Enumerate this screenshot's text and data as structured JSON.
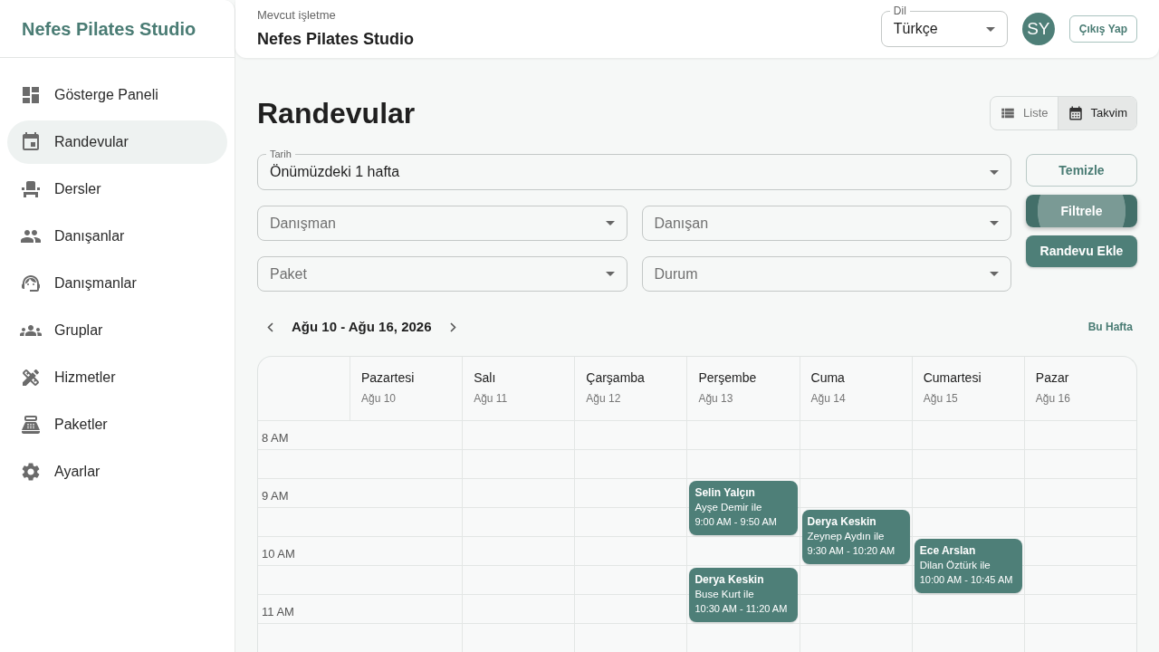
{
  "sidebar": {
    "logo": "Nefes Pilates Studio",
    "items": [
      {
        "label": "Gösterge Paneli",
        "selected": false
      },
      {
        "label": "Randevular",
        "selected": true
      },
      {
        "label": "Dersler",
        "selected": false
      },
      {
        "label": "Danışanlar",
        "selected": false
      },
      {
        "label": "Danışmanlar",
        "selected": false
      },
      {
        "label": "Gruplar",
        "selected": false
      },
      {
        "label": "Hizmetler",
        "selected": false
      },
      {
        "label": "Paketler",
        "selected": false
      },
      {
        "label": "Ayarlar",
        "selected": false
      }
    ]
  },
  "header": {
    "caption": "Mevcut işletme",
    "business": "Nefes Pilates Studio",
    "language": {
      "label": "Dil",
      "value": "Türkçe"
    },
    "avatar": "SY",
    "logout": "Çıkış Yap"
  },
  "page": {
    "title": "Randevular",
    "views": [
      {
        "label": "Liste",
        "selected": false
      },
      {
        "label": "Takvim",
        "selected": true
      }
    ]
  },
  "filters": {
    "date": {
      "label": "Tarih",
      "value": "Önümüzdeki 1 hafta"
    },
    "selects": [
      {
        "placeholder": "Danışman"
      },
      {
        "placeholder": "Danışan"
      },
      {
        "placeholder": "Paket"
      },
      {
        "placeholder": "Durum"
      }
    ],
    "buttons": [
      {
        "label": "Temizle",
        "kind": "outlined",
        "focused": false
      },
      {
        "label": "Filtrele",
        "kind": "contained",
        "focused": true
      },
      {
        "label": "Randevu Ekle",
        "kind": "contained",
        "focused": false
      }
    ]
  },
  "week": {
    "range": "Ağu 10 - Ağu 16, 2026",
    "current": "Bu Hafta"
  },
  "calendar": {
    "days": [
      {
        "name": "Pazartesi",
        "date": "Ağu 10"
      },
      {
        "name": "Salı",
        "date": "Ağu 11"
      },
      {
        "name": "Çarşamba",
        "date": "Ağu 12"
      },
      {
        "name": "Perşembe",
        "date": "Ağu 13"
      },
      {
        "name": "Cuma",
        "date": "Ağu 14"
      },
      {
        "name": "Cumartesi",
        "date": "Ağu 15"
      },
      {
        "name": "Pazar",
        "date": "Ağu 16"
      }
    ],
    "rows": [
      {
        "label": "8 AM",
        "cells": [
          {
            "kind": "free"
          },
          {
            "kind": "free"
          },
          {
            "kind": "free"
          },
          {
            "kind": "free"
          },
          {
            "kind": "free"
          },
          {
            "kind": "free"
          },
          {
            "kind": "free"
          }
        ]
      },
      {
        "cells": [
          {
            "kind": "free"
          },
          {
            "kind": "free"
          },
          {
            "kind": "free"
          },
          {
            "kind": "free"
          },
          {
            "kind": "free"
          },
          {
            "kind": "free"
          },
          {
            "kind": "free"
          }
        ]
      },
      {
        "label": "9 AM",
        "cells": [
          {
            "kind": "free"
          },
          {
            "kind": "free"
          },
          {
            "kind": "free"
          },
          {
            "kind": "event",
            "title": "Selin Yalçın",
            "subtitle": "Ayşe Demir ile",
            "time": "9:00 AM - 9:50 AM"
          },
          {
            "kind": "free"
          },
          {
            "kind": "free"
          },
          {
            "kind": "free"
          }
        ]
      },
      {
        "cells": [
          {
            "kind": "free"
          },
          {
            "kind": "free"
          },
          {
            "kind": "free"
          },
          {
            "kind": "free"
          },
          {
            "kind": "event",
            "title": "Derya Keskin",
            "subtitle": "Zeynep Aydın ile",
            "time": "9:30 AM - 10:20 AM"
          },
          {
            "kind": "free"
          },
          {
            "kind": "free"
          }
        ]
      },
      {
        "label": "10 AM",
        "cells": [
          {
            "kind": "free"
          },
          {
            "kind": "free"
          },
          {
            "kind": "free"
          },
          {
            "kind": "free"
          },
          {
            "kind": "free"
          },
          {
            "kind": "event",
            "title": "Ece Arslan",
            "subtitle": "Dilan Öztürk ile",
            "time": "10:00 AM - 10:45 AM"
          },
          {
            "kind": "free"
          }
        ]
      },
      {
        "cells": [
          {
            "kind": "free"
          },
          {
            "kind": "free"
          },
          {
            "kind": "free"
          },
          {
            "kind": "event",
            "title": "Derya Keskin",
            "subtitle": "Buse Kurt ile",
            "time": "10:30 AM - 11:20 AM"
          },
          {
            "kind": "free"
          },
          {
            "kind": "free"
          },
          {
            "kind": "free"
          }
        ]
      },
      {
        "label": "11 AM",
        "cells": [
          {
            "kind": "free"
          },
          {
            "kind": "free"
          },
          {
            "kind": "free"
          },
          {
            "kind": "free"
          },
          {
            "kind": "free"
          },
          {
            "kind": "free"
          },
          {
            "kind": "free"
          }
        ]
      },
      {
        "cells": [
          {
            "kind": "free"
          },
          {
            "kind": "free"
          },
          {
            "kind": "free"
          },
          {
            "kind": "free"
          },
          {
            "kind": "free"
          },
          {
            "kind": "free"
          },
          {
            "kind": "free"
          }
        ]
      }
    ]
  }
}
